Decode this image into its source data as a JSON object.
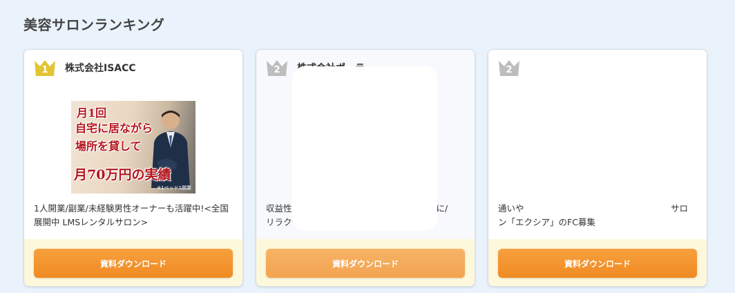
{
  "section": {
    "title": "美容サロンランキング"
  },
  "cards": [
    {
      "rank": "1",
      "crown_color": "#e2c433",
      "company": "株式会社ISACC",
      "banner": {
        "line1": "月1回",
        "line2": "自宅に居ながら",
        "line3": "場所を貸して",
        "line4": "月70万円の実績",
        "credit": "※1ベッド1開業"
      },
      "description": "1人開業/副業/未経験男性オーナーも活躍中!<全国展開中 LMSレンタルサロン>",
      "button_label": "資料ダウンロード"
    },
    {
      "rank": "2",
      "crown_color": "#bdbdbd",
      "company": "株式会社ポーラ",
      "description_left": "収益性",
      "description_right": "舗に/",
      "description_line2": "リラクセ",
      "button_label": "資料ダウンロード"
    },
    {
      "rank": "2",
      "crown_color": "#bdbdbd",
      "company": "",
      "description_left": "通いや",
      "description_right": "サロ",
      "description_line2": "ン「エクシア」のFC募集",
      "button_label": "資料ダウンロード"
    }
  ]
}
